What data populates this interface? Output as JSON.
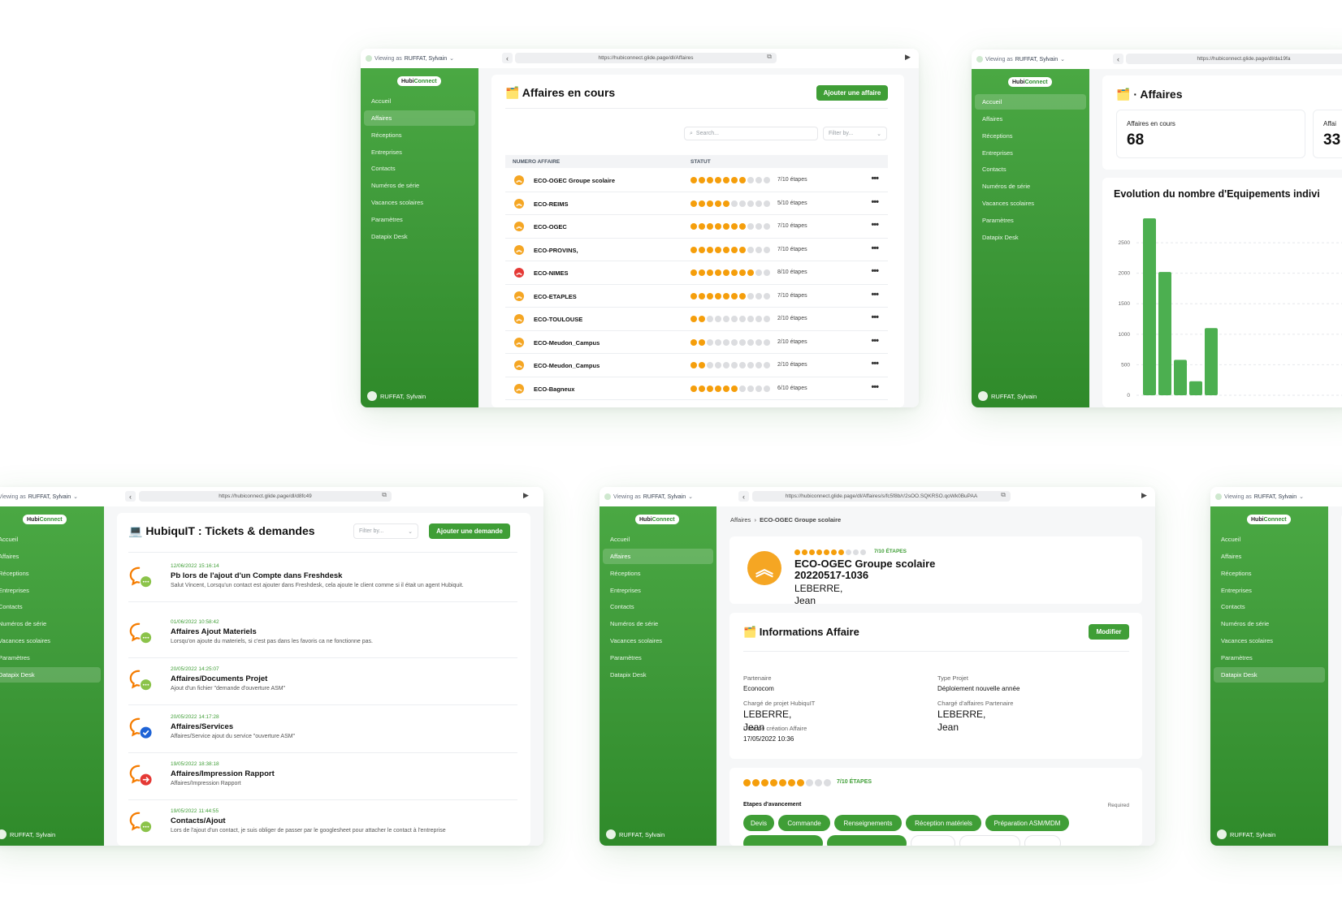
{
  "common": {
    "viewing_label": "Viewing as",
    "viewing_user": "RUFFAT, Sylvain",
    "logo_a": "Hubi",
    "logo_b": "Connect",
    "nav": [
      "Accueil",
      "Affaires",
      "Réceptions",
      "Entreprises",
      "Contacts",
      "Numéros de série",
      "Vacances scolaires",
      "Paramètres",
      "Datapix Desk"
    ],
    "user_name": "RUFFAT, Sylvain",
    "brand_green": "#3f9e36",
    "step_orange": "#f59e0b"
  },
  "win_affaires": {
    "url": "https://hubiconnect.glide.page/dl/Affaires",
    "title": "🗂️ Affaires en cours",
    "add_button": "Ajouter une affaire",
    "search_placeholder": "Search...",
    "filter_placeholder": "Filter by...",
    "col_numero": "NUMERO AFFAIRE",
    "col_statut": "STATUT",
    "rows": [
      {
        "name": "ECO-OGEC Groupe scolaire",
        "done": 7,
        "total": 10,
        "label": "7/10 étapes",
        "icon": "orange"
      },
      {
        "name": "ECO-REIMS",
        "done": 5,
        "total": 10,
        "label": "5/10 étapes",
        "icon": "orange"
      },
      {
        "name": "ECO-OGEC",
        "done": 7,
        "total": 10,
        "label": "7/10 étapes",
        "icon": "orange"
      },
      {
        "name": "ECO-PROVINS,",
        "done": 7,
        "total": 10,
        "label": "7/10 étapes",
        "icon": "orange"
      },
      {
        "name": "ECO-NIMES",
        "done": 8,
        "total": 10,
        "label": "8/10 étapes",
        "icon": "red"
      },
      {
        "name": "ECO-ETAPLES",
        "done": 7,
        "total": 10,
        "label": "7/10 étapes",
        "icon": "orange"
      },
      {
        "name": "ECO-TOULOUSE",
        "done": 2,
        "total": 10,
        "label": "2/10 étapes",
        "icon": "orange"
      },
      {
        "name": "ECO-Meudon_Campus",
        "done": 2,
        "total": 10,
        "label": "2/10 étapes",
        "icon": "orange"
      },
      {
        "name": "ECO-Meudon_Campus",
        "done": 2,
        "total": 10,
        "label": "2/10 étapes",
        "icon": "orange"
      },
      {
        "name": "ECO-Bagneux",
        "done": 6,
        "total": 10,
        "label": "6/10 étapes",
        "icon": "orange"
      }
    ]
  },
  "win_dashboard": {
    "url": "https://hubiconnect.glide.page/dl/da19fa",
    "title": "🗂️ · Affaires",
    "kpi1_label": "Affaires en cours",
    "kpi1_value": "68",
    "kpi2_label": "Affai",
    "kpi2_value": "33",
    "chart_title": "Evolution du nombre d'Equipements indivi"
  },
  "chart_data": {
    "type": "bar",
    "title": "Evolution du nombre d'Equipements indivi",
    "y_ticks": [
      "0",
      "500",
      "1000",
      "1500",
      "2000",
      "2500"
    ],
    "ylim": [
      0,
      2900
    ],
    "values": [
      2900,
      2020,
      580,
      230,
      1100
    ],
    "grid": true
  },
  "win_tickets": {
    "url": "https://hubiconnect.glide.page/dl/d8fc49",
    "title": "💻 HubiquIT : Tickets & demandes",
    "filter_placeholder": "Filter by...",
    "add_button": "Ajouter une demande",
    "tickets": [
      {
        "date": "12/06/2022 15:16:14",
        "title": "Pb lors de l'ajout d'un Compte dans Freshdesk",
        "desc": "Salut Vincent, Lorsqu'un contact est ajouter dans Freshdesk, cela ajoute le client comme si il était un agent Hubiquit.",
        "badge": "chat"
      },
      {
        "date": "01/06/2022 10:58:42",
        "title": "Affaires Ajout Materiels",
        "desc": "Lorsqu'on ajoute du materiels, si c'est pas dans les favoris ca ne fonctionne pas.",
        "badge": "chat"
      },
      {
        "date": "20/05/2022 14:25:07",
        "title": "Affaires/Documents Projet",
        "desc": "Ajout d'un fichier \"demande d'ouverture ASM\"",
        "badge": "chat"
      },
      {
        "date": "20/05/2022 14:17:28",
        "title": "Affaires/Services",
        "desc": "Affaires/Service ajout du service \"ouverture ASM\"",
        "badge": "check"
      },
      {
        "date": "19/05/2022 18:38:18",
        "title": "Affaires/Impression Rapport",
        "desc": "Affaires/Impression Rapport",
        "badge": "arrow"
      },
      {
        "date": "19/05/2022 11:44:55",
        "title": "Contacts/Ajout",
        "desc": "Lors de l'ajout d'un contact, je suis obliger de passer par le googlesheet pour attacher le contact à l'entreprise",
        "badge": "chat"
      }
    ]
  },
  "win_detail": {
    "url": "https://hubiconnect.glide.page/dl/Affaires/s/fc5f8b/r/2sOO.SQKRSO.qoWk0BuPAA",
    "crumb_root": "Affaires",
    "crumb_sep": "›",
    "crumb_current": "ECO-OGEC Groupe scolaire",
    "step_label": "7/10 ÉTAPES",
    "steps_done": 7,
    "steps_total": 10,
    "name_line1": "ECO-OGEC Groupe scolaire",
    "name_line2": "20220517-1036",
    "owner_line1": "LEBERRE,",
    "owner_line2": "Jean",
    "info_title": "🗂️ Informations Affaire",
    "edit_button": "Modifier",
    "partenaire_label": "Partenaire",
    "partenaire_value": "Econocom",
    "type_label": "Type Projet",
    "type_value": "Déploiement nouvelle année",
    "charge_hubiquit_label": "Chargé de projet HubiquIT",
    "charge_hubiquit_l1": "LEBERRE,",
    "charge_hubiquit_l2": "Jean",
    "charge_part_label": "Chargé d'affaires Partenaire",
    "charge_part_l1": "LEBERRE,",
    "charge_part_l2": "Jean",
    "creation_label": "Date de création Affaire",
    "creation_value": "17/05/2022 10:36",
    "steps_section_label": "Etapes d'avancement",
    "required_label": "Required",
    "chips": [
      "Devis",
      "Commande",
      "Renseignements",
      "Réception matériels",
      "Préparation ASM/MDM"
    ]
  },
  "win_right": {
    "active_nav": 8
  }
}
